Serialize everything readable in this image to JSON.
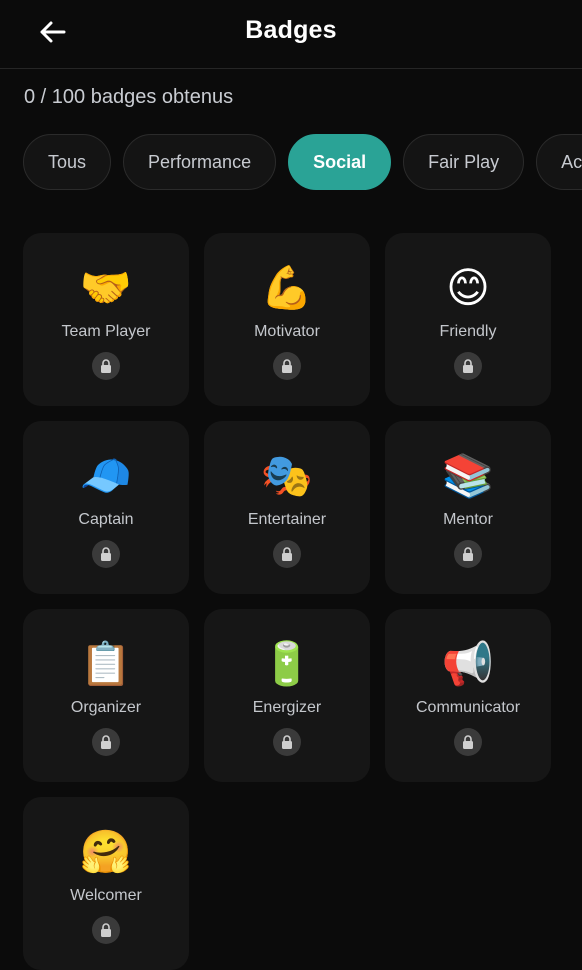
{
  "header": {
    "title": "Badges"
  },
  "summary": {
    "count_text": "0 / 100 badges obtenus"
  },
  "tabs": [
    {
      "label": "Tous",
      "active": false
    },
    {
      "label": "Performance",
      "active": false
    },
    {
      "label": "Social",
      "active": true
    },
    {
      "label": "Fair Play",
      "active": false
    },
    {
      "label": "Ac",
      "active": false
    }
  ],
  "badges": [
    {
      "name": "Team Player",
      "emoji": "🤝",
      "locked": true
    },
    {
      "name": "Motivator",
      "emoji": "💪",
      "locked": true
    },
    {
      "name": "Friendly",
      "emoji": "😊",
      "locked": true
    },
    {
      "name": "Captain",
      "emoji": "🧢",
      "locked": true
    },
    {
      "name": "Entertainer",
      "emoji": "🎭",
      "locked": true
    },
    {
      "name": "Mentor",
      "emoji": "📚",
      "locked": true
    },
    {
      "name": "Organizer",
      "emoji": "📋",
      "locked": true
    },
    {
      "name": "Energizer",
      "emoji": "🔋",
      "locked": true
    },
    {
      "name": "Communicator",
      "emoji": "📢",
      "locked": true
    },
    {
      "name": "Welcomer",
      "emoji": "🤗",
      "locked": true
    }
  ],
  "colors": {
    "accent": "#2aa396",
    "background": "#0b0b0b",
    "card": "#161616"
  }
}
